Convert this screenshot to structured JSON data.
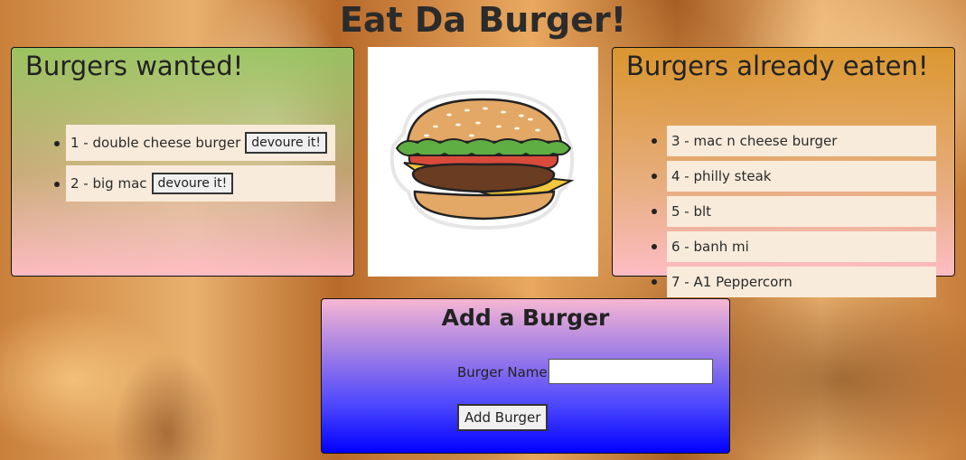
{
  "page": {
    "title": "Eat Da Burger!"
  },
  "wanted": {
    "heading": "Burgers wanted!",
    "items": [
      {
        "label": "1 - double cheese burger",
        "button": "devoure it!"
      },
      {
        "label": "2 - big mac",
        "button": "devoure it!"
      }
    ]
  },
  "eaten": {
    "heading": "Burgers already eaten!",
    "items": [
      {
        "label": "3 - mac n cheese burger"
      },
      {
        "label": "4 - philly steak"
      },
      {
        "label": "5 - blt"
      },
      {
        "label": "6 - banh mi"
      },
      {
        "label": "7 - A1 Peppercorn"
      }
    ]
  },
  "image": {
    "icon": "burger-icon"
  },
  "add_form": {
    "heading": "Add a Burger",
    "field_label": "Burger Name:",
    "field_value": "",
    "submit_label": "Add Burger"
  }
}
